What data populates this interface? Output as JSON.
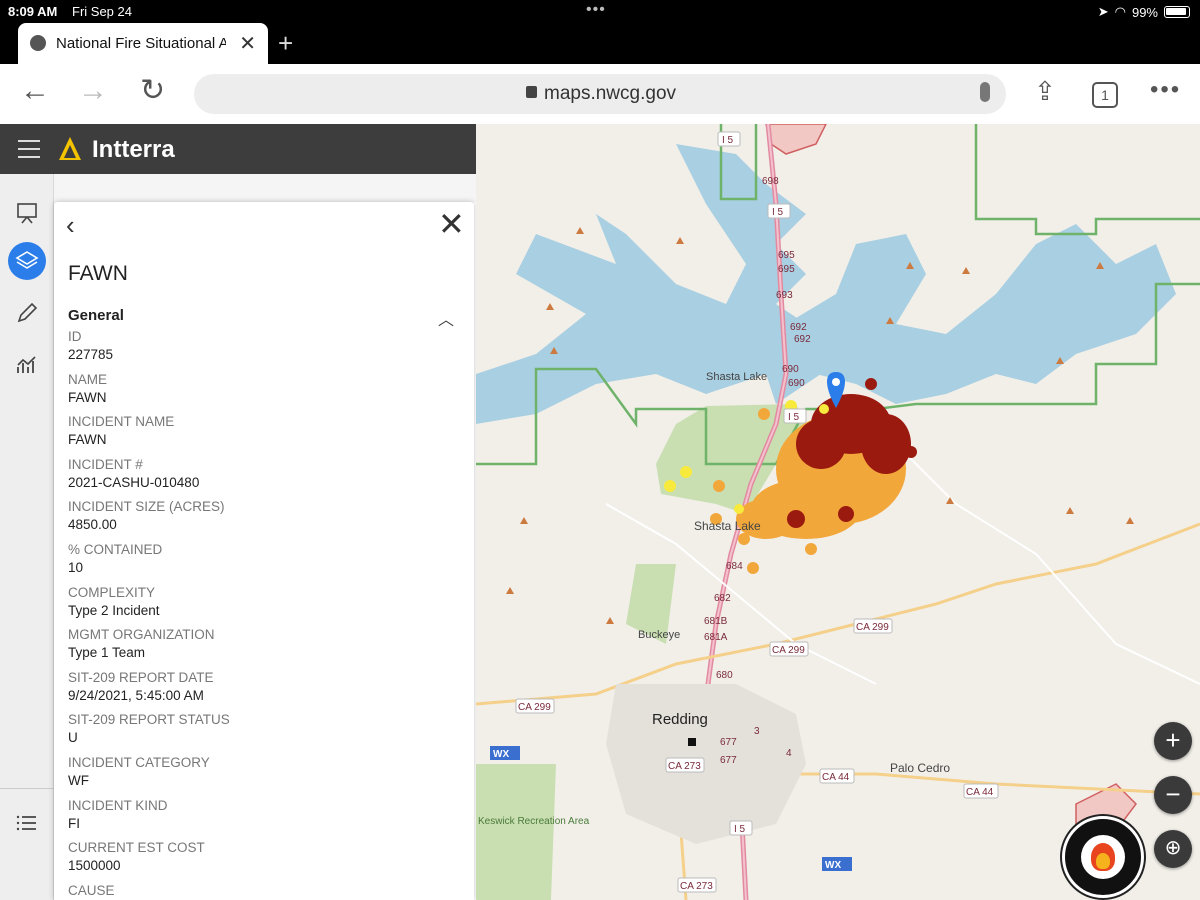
{
  "status_bar": {
    "time": "8:09 AM",
    "date": "Fri Sep 24",
    "battery": "99%"
  },
  "browser": {
    "tab_title": "National Fire Situational Awareness",
    "url": "maps.nwcg.gov",
    "tab_count": "1"
  },
  "app": {
    "name": "Intterra"
  },
  "panel": {
    "title": "FAWN",
    "section": "General",
    "fields": [
      {
        "label": "ID",
        "value": "227785"
      },
      {
        "label": "NAME",
        "value": "FAWN"
      },
      {
        "label": "INCIDENT NAME",
        "value": "FAWN"
      },
      {
        "label": "INCIDENT #",
        "value": "2021-CASHU-010480"
      },
      {
        "label": "INCIDENT SIZE (ACRES)",
        "value": "4850.00"
      },
      {
        "label": "% CONTAINED",
        "value": "10"
      },
      {
        "label": "COMPLEXITY",
        "value": "Type 2 Incident"
      },
      {
        "label": "MGMT ORGANIZATION",
        "value": "Type 1 Team"
      },
      {
        "label": "SIT-209 REPORT DATE",
        "value": "9/24/2021, 5:45:00 AM"
      },
      {
        "label": "SIT-209 REPORT STATUS",
        "value": "U"
      },
      {
        "label": "INCIDENT CATEGORY",
        "value": "WF"
      },
      {
        "label": "INCIDENT KIND",
        "value": "FI"
      },
      {
        "label": "CURRENT EST COST",
        "value": "1500000"
      },
      {
        "label": "CAUSE",
        "value": ""
      }
    ]
  },
  "map": {
    "places": [
      "Shasta Lake",
      "Shasta Lake",
      "Buckeye",
      "Redding",
      "Palo Cedro",
      "Keswick Recreation Area"
    ],
    "roads": [
      "I 5",
      "I 5",
      "I 5",
      "I 5",
      "CA 299",
      "CA 299",
      "CA 299",
      "CA 273",
      "CA 273",
      "CA 44",
      "CA 44"
    ],
    "exits": [
      "698",
      "695",
      "695",
      "693",
      "692",
      "692",
      "690",
      "690",
      "684",
      "682",
      "681B",
      "681A",
      "680",
      "677",
      "677",
      "3",
      "4"
    ],
    "weather_label": "WX",
    "badge_text": "NATIONAL INTERAGENCY FIRE CENTER",
    "colors": {
      "heat_dark": "#9b1a0f",
      "heat_orange": "#f2a73b",
      "heat_yellow": "#f7ea3c",
      "water": "#a9cfe2",
      "forest": "#c9dfb1"
    }
  }
}
